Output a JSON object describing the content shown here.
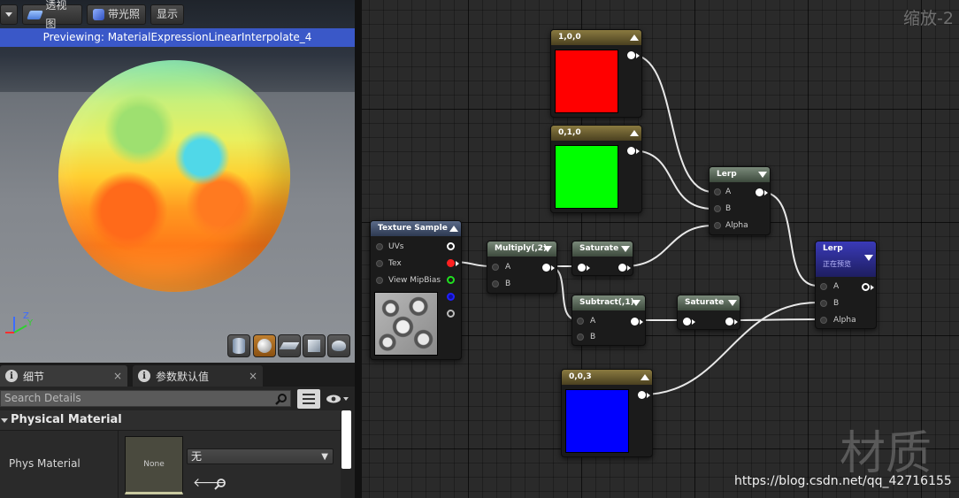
{
  "viewport": {
    "toolbar": {
      "perspective_label": "透视图",
      "lit_label": "带光照",
      "show_label": "显示"
    },
    "preview_text": "Previewing: MaterialExpressionLinearInterpolate_4",
    "axis": {
      "z": "Z",
      "y": "Y"
    }
  },
  "details": {
    "tabs": [
      {
        "label": "细节",
        "close": "×"
      },
      {
        "label": "参数默认值",
        "close": "×"
      }
    ],
    "search_placeholder": "Search Details",
    "category": "Physical Material",
    "property": {
      "label": "Phys Material",
      "thumbnail_text": "None",
      "value": "无"
    }
  },
  "graph": {
    "zoom": "缩放-2",
    "watermark": "材质",
    "url": "https://blog.csdn.net/qq_42716155",
    "nodes": {
      "red_const": {
        "title": "1,0,0",
        "color": "#ff0000"
      },
      "green_const": {
        "title": "0,1,0",
        "color": "#00ff00"
      },
      "blue_const": {
        "title": "0,0,3",
        "color": "#0000ff"
      },
      "lerp1": {
        "title": "Lerp",
        "pins": [
          "A",
          "B",
          "Alpha"
        ]
      },
      "texture": {
        "title": "Texture Sample",
        "pins": [
          "UVs",
          "Tex",
          "View MipBias"
        ]
      },
      "multiply": {
        "title": "Multiply(,2)",
        "pins": [
          "A",
          "B"
        ]
      },
      "saturate1": {
        "title": "Saturate"
      },
      "subtract": {
        "title": "Subtract(,1)",
        "pins": [
          "A",
          "B"
        ]
      },
      "saturate2": {
        "title": "Saturate"
      },
      "lerp2": {
        "title": "Lerp",
        "subtitle": "正在预览",
        "pins": [
          "A",
          "B",
          "Alpha"
        ]
      }
    }
  },
  "colors": {
    "accent": "#3a58c8",
    "pin_red": "#ff2020",
    "pin_green": "#20e020",
    "pin_blue": "#2020ff"
  }
}
